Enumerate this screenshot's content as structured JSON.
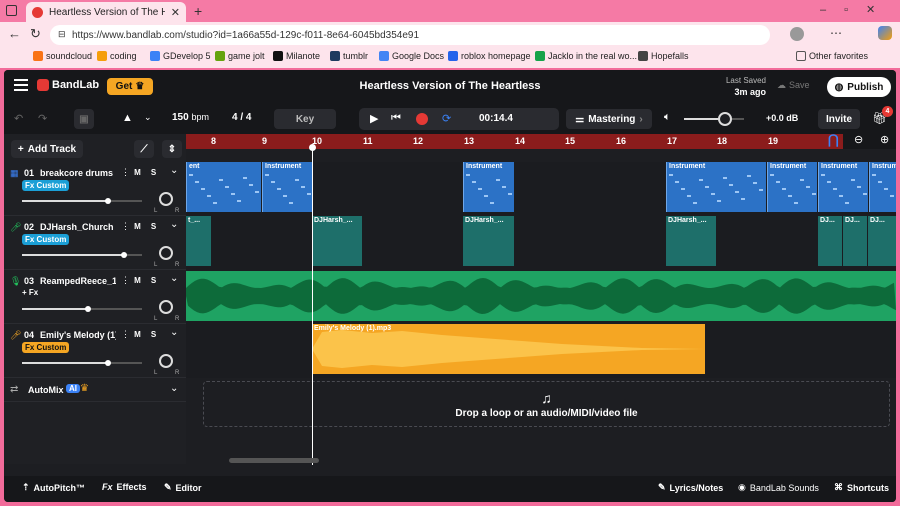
{
  "browser": {
    "tab_title": "Heartless Version of The Heartless",
    "url": "https://www.bandlab.com/studio?id=1a66a55d-129c-f011-8e64-6045bd354e91",
    "favorites": [
      "soundcloud",
      "coding",
      "GDevelop 5",
      "game jolt",
      "Milanote",
      "tumblr",
      "Google Docs",
      "roblox homepage",
      "Jacklo in the real wo...",
      "Hopefalls"
    ],
    "other_favorites": "Other favorites"
  },
  "header": {
    "logo": "BandLab",
    "get_label": "Get",
    "project_title": "Heartless Version of The Heartless",
    "last_saved_label": "Last Saved",
    "last_saved_value": "3m ago",
    "save_label": "Save",
    "publish_label": "Publish"
  },
  "toolbar": {
    "bpm_value": "150",
    "bpm_unit": "bpm",
    "time_signature": "4 / 4",
    "key_label": "Key",
    "time_display": "00:14.4",
    "mastering_label": "Mastering",
    "volume_db": "+0.0 dB",
    "invite_label": "Invite",
    "notif_count": "4"
  },
  "add_track_label": "Add Track",
  "ruler": [
    "8",
    "9",
    "10",
    "11",
    "12",
    "13",
    "14",
    "15",
    "16",
    "17",
    "18",
    "19"
  ],
  "tracks": [
    {
      "num": "01",
      "name": "breakcore drums",
      "fx": "Fx Custom",
      "fx_style": "blue",
      "volume_level": 0.72
    },
    {
      "num": "02",
      "name": "DJHarsh_Church B...",
      "fx": "Fx Custom",
      "fx_style": "blue",
      "volume_level": 0.85
    },
    {
      "num": "03",
      "name": "ReampedReece_17...",
      "fx": "+ Fx",
      "fx_style": "plain",
      "volume_level": 0.55
    },
    {
      "num": "04",
      "name": "Emily's Melody (1)...",
      "fx": "Fx Custom",
      "fx_style": "yellow",
      "volume_level": 0.72
    }
  ],
  "ms": {
    "m": "M",
    "s": "S",
    "pan_l": "L",
    "pan_r": "R"
  },
  "clips": {
    "instrument": "Instrument",
    "djharsh": "DJHarsh_...",
    "dj_short": "DJ...",
    "emily": "Emily's Melody (1).mp3",
    "partial": "ent",
    "partial2": "t_..."
  },
  "automix": {
    "label": "AutoMix",
    "badge": "AI"
  },
  "drop_text": "Drop a loop or an audio/MIDI/video file",
  "bottom": {
    "autopitch": "AutoPitch™",
    "effects": "Effects",
    "editor": "Editor",
    "lyrics": "Lyrics/Notes",
    "sounds": "BandLab Sounds",
    "shortcuts": "Shortcuts"
  }
}
